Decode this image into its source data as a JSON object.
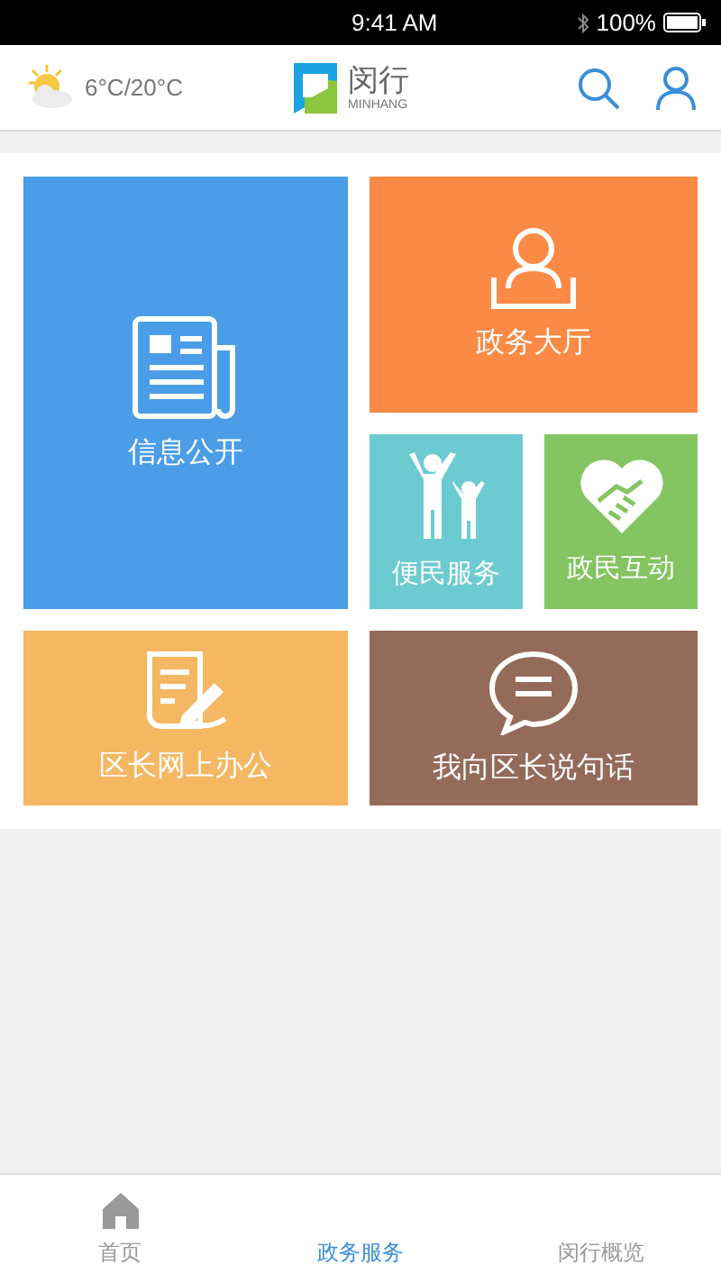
{
  "status_bar": {
    "time": "9:41 AM",
    "battery": "100%"
  },
  "header": {
    "weather": "6°C/20°C",
    "logo_title": "闵行",
    "logo_subtitle": "MINHANG"
  },
  "tiles": [
    {
      "label": "信息公开",
      "kind": "news",
      "color": "#4a9de6"
    },
    {
      "label": "政务大厅",
      "kind": "desk",
      "color": "#fa8a45"
    },
    {
      "label": "便民服务",
      "kind": "family",
      "color": "#6ccbd0"
    },
    {
      "label": "政民互动",
      "kind": "handshake",
      "color": "#84c461"
    },
    {
      "label": "区长网上办公",
      "kind": "memo",
      "color": "#f4b862"
    },
    {
      "label": "我向区长说句话",
      "kind": "chat",
      "color": "#946a59"
    }
  ],
  "tab_bar": [
    {
      "label": "首页",
      "selected": false
    },
    {
      "label": "政务服务",
      "selected": true
    },
    {
      "label": "闵行概览",
      "selected": false
    }
  ]
}
